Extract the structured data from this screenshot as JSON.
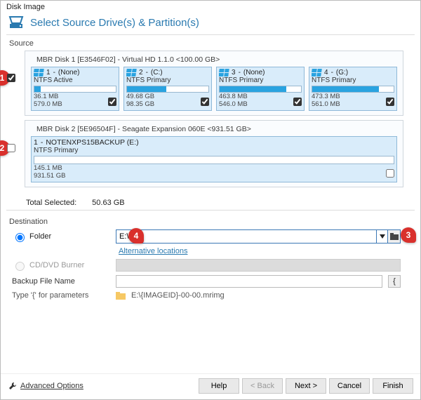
{
  "window": {
    "title": "Disk Image"
  },
  "header": {
    "title": "Select Source Drive(s) & Partition(s)"
  },
  "source": {
    "label": "Source",
    "disks": [
      {
        "badge": "1",
        "checked": true,
        "title": "MBR Disk 1 [E3546F02] - Virtual HD 1.1.0  <100.00 GB>",
        "partitions": [
          {
            "num": "1",
            "drive": "(None)",
            "type": "NTFS Active",
            "used": "36.1 MB",
            "total": "579.0 MB",
            "fill": 8,
            "checked": true
          },
          {
            "num": "2",
            "drive": "(C:)",
            "type": "NTFS Primary",
            "used": "49.68 GB",
            "total": "98.35 GB",
            "fill": 48,
            "checked": true
          },
          {
            "num": "3",
            "drive": "(None)",
            "type": "NTFS Primary",
            "used": "463.8 MB",
            "total": "546.0 MB",
            "fill": 82,
            "checked": true
          },
          {
            "num": "4",
            "drive": "(G:)",
            "type": "NTFS Primary",
            "used": "473.3 MB",
            "total": "561.0 MB",
            "fill": 82,
            "checked": true
          }
        ]
      },
      {
        "badge": "2",
        "checked": false,
        "title": "MBR Disk 2 [5E96504F] - Seagate  Expansion      060E  <931.51 GB>",
        "partitions": [
          {
            "num": "1",
            "label": "NOTENXPS15BACKUP (E:)",
            "type": "NTFS Primary",
            "used": "145.1 MB",
            "total": "931.51 GB",
            "fill": 0,
            "checked": false
          }
        ]
      }
    ],
    "total_label": "Total Selected:",
    "total_value": "50.63 GB"
  },
  "destination": {
    "label": "Destination",
    "folder_label": "Folder",
    "folder_value": "E:\\",
    "folder_badge_inner": "4",
    "folder_badge_browse": "3",
    "alt_link": "Alternative locations",
    "burner_label": "CD/DVD Burner",
    "filename_label": "Backup File Name",
    "filename_value": "",
    "params_label": "Type '{' for parameters",
    "params_value": "E:\\{IMAGEID}-00-00.mrimg"
  },
  "footer": {
    "advanced": "Advanced Options",
    "help": "Help",
    "back": "< Back",
    "next": "Next >",
    "cancel": "Cancel",
    "finish": "Finish"
  }
}
